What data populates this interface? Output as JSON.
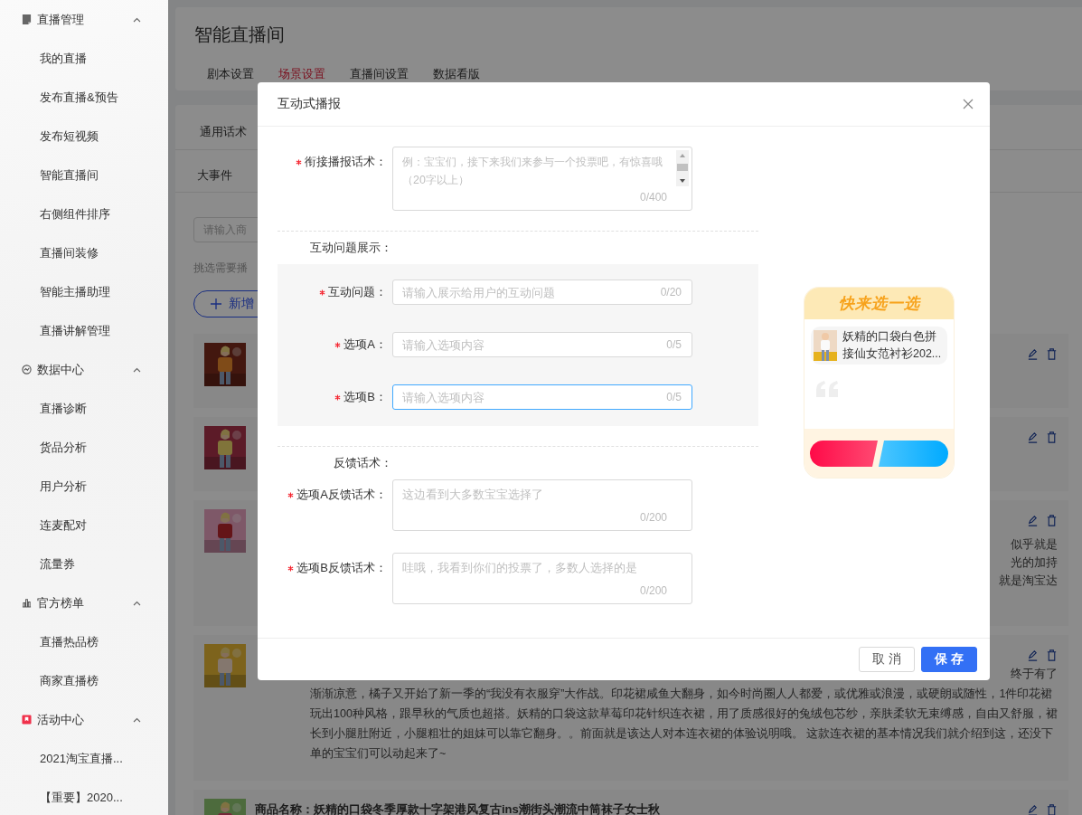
{
  "sidebar": {
    "groups": [
      {
        "title": "直播管理",
        "kind": "document",
        "expanded": true,
        "items": [
          "我的直播",
          "发布直播&预告",
          "发布短视频",
          "智能直播间",
          "右侧组件排序",
          "直播间装修",
          "智能主播助理",
          "直播讲解管理"
        ]
      },
      {
        "title": "数据中心",
        "kind": "dashboard",
        "expanded": true,
        "items": [
          "直播诊断",
          "货品分析",
          "用户分析",
          "连麦配对",
          "流量券"
        ]
      },
      {
        "title": "官方榜单",
        "kind": "ranking",
        "expanded": true,
        "items": [
          "直播热品榜",
          "商家直播榜"
        ]
      },
      {
        "title": "活动中心",
        "kind": "activity",
        "expanded": true,
        "items": [
          "2021淘宝直播...",
          "【重要】2020..."
        ]
      }
    ]
  },
  "page": {
    "title": "智能直播间",
    "tabs": [
      {
        "label": "剧本设置",
        "selected": false
      },
      {
        "label": "场景设置",
        "selected": true
      },
      {
        "label": "直播间设置",
        "selected": false
      },
      {
        "label": "数据看版",
        "selected": false
      }
    ]
  },
  "script_panel": {
    "tab": "通用话术",
    "event_label": "大事件",
    "search": {
      "placeholder": "请输入商"
    },
    "hint": "挑选需要播",
    "add_button": "新增",
    "items": [
      {
        "kind": "covered"
      },
      {
        "kind": "covered"
      },
      {
        "kind": "fragments",
        "lines": [
          "似乎就是",
          "光的加持",
          "就是淘宝达"
        ]
      },
      {
        "kind": "description",
        "fragment": "终于有了",
        "lines": [
          "渐渐凉意，橘子又开始了新一季的“我没有衣服穿”大作战。印花裙咸鱼大翻身，如今时尚圈人人都爱，或优雅或浪漫，或硬朗或随性，1件印花裙",
          "玩出100种风格，跟早秋的气质也超搭。妖精的口袋这款草莓印花针织连衣裙，用了质感很好的兔绒包芯纱，亲肤柔软无束缚感，自由又舒服，裙",
          "长到小腿肚附近，小腿粗壮的姐妹可以靠它翻身。。前面就是该达人对本连衣裙的体验说明哦。 这款连衣裙的基本情况我们就介绍到这，还没下",
          "单的宝宝们可以动起来了~"
        ]
      },
      {
        "kind": "titled",
        "title": "商品名称：妖精的口袋冬季厚款十字架港风复古ins潮街头潮流中筒袜子女士秋"
      }
    ]
  },
  "dialog": {
    "title": "互动式播报",
    "sections": [
      {
        "kind": "plain",
        "fields": [
          {
            "kind": "long_textarea",
            "label": "衔接播报话术：",
            "required": true,
            "placeholder": "例：宝宝们，接下来我们来参与一个投票吧，有惊喜哦（20字以上）",
            "counter": "0/400",
            "focused": false
          }
        ]
      },
      {
        "kind": "panel",
        "heading": "互动问题展示：",
        "fields": [
          {
            "kind": "input",
            "label": "互动问题：",
            "required": true,
            "placeholder": "请输入展示给用户的互动问题",
            "counter": "0/20",
            "focused": false
          },
          {
            "kind": "input",
            "label": "选项A：",
            "required": true,
            "placeholder": "请输入选项内容",
            "counter": "0/5",
            "focused": false
          },
          {
            "kind": "input",
            "label": "选项B：",
            "required": true,
            "placeholder": "请输入选项内容",
            "counter": "0/5",
            "focused": true
          }
        ]
      },
      {
        "kind": "plain",
        "heading": "反馈话术：",
        "fields": [
          {
            "kind": "textarea",
            "label": "选项A反馈话术：",
            "required": true,
            "placeholder": "这边看到大多数宝宝选择了",
            "counter": "0/200",
            "focused": false
          },
          {
            "kind": "textarea",
            "label": "选项B反馈话术：",
            "required": true,
            "placeholder": "哇哦，我看到你们的投票了，多数人选择的是",
            "counter": "0/200",
            "focused": false
          }
        ]
      }
    ],
    "preview": {
      "title": "快来选一选",
      "product": "妖精的口袋白色拼接仙女范衬衫202..."
    },
    "buttons": [
      {
        "label": "取 消",
        "kind": "secondary"
      },
      {
        "label": "保 存",
        "kind": "primary"
      }
    ]
  }
}
